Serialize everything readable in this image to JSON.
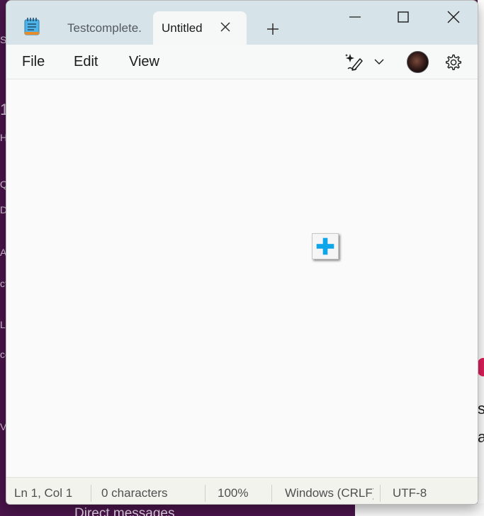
{
  "background": {
    "left_fragments": [
      "S",
      "1",
      "H",
      "Q",
      "D",
      "A",
      "ct",
      "L",
      "cc",
      "V"
    ],
    "right_fragments": [
      "s",
      "a"
    ],
    "bottom_text": "Direct messages"
  },
  "window": {
    "tabs": [
      {
        "title": "Testcomplete."
      },
      {
        "title": "Untitled"
      }
    ],
    "icons": {
      "app": "notepad-icon",
      "tab_close": "close-icon",
      "new_tab": "plus-icon",
      "minimize": "minimize-icon",
      "maximize": "maximize-icon",
      "close": "close-icon",
      "copilot": "copilot-sparkle-pen-icon",
      "copilot_menu": "chevron-down-icon",
      "settings": "gear-icon",
      "cursor": "plus-cursor-icon"
    }
  },
  "menubar": {
    "file": "File",
    "edit": "Edit",
    "view": "View"
  },
  "editor": {
    "content": ""
  },
  "statusbar": {
    "position": "Ln 1, Col 1",
    "characters": "0 characters",
    "zoom": "100%",
    "line_ending": "Windows (CRLF)",
    "encoding": "UTF-8"
  },
  "colors": {
    "titlebar": "#d6e3e8",
    "active_tab": "#f6f7f7",
    "editor_bg": "#fafafa",
    "statusbar_bg": "#f3f3ee",
    "cursor_plus": "#0ea5e9",
    "background_app": "#4a154b"
  }
}
